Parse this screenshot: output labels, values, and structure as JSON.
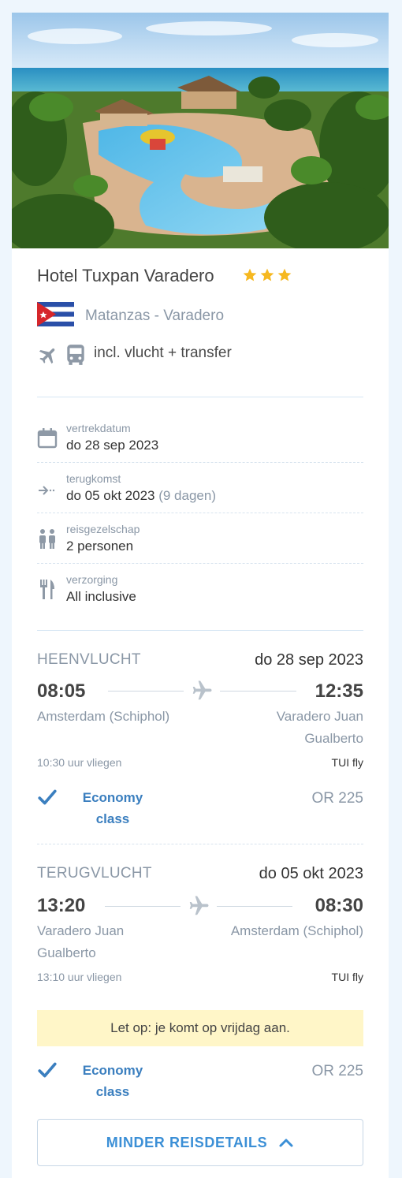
{
  "hotel": {
    "name": "Hotel Tuxpan Varadero",
    "stars": 3,
    "location": "Matanzas - Varadero",
    "includes": "incl. vlucht + transfer",
    "icons": [
      "plane-icon",
      "bus-icon"
    ]
  },
  "details": [
    {
      "icon": "calendar-icon",
      "label": "vertrekdatum",
      "value": "do 28 sep 2023",
      "extra": ""
    },
    {
      "icon": "arrow-right-icon",
      "label": "terugkomst",
      "value": "do 05 okt 2023",
      "extra": "(9 dagen)"
    },
    {
      "icon": "people-icon",
      "label": "reisgezelschap",
      "value": "2 personen",
      "extra": ""
    },
    {
      "icon": "cutlery-icon",
      "label": "verzorging",
      "value": "All inclusive",
      "extra": ""
    }
  ],
  "outbound": {
    "title": "HEENVLUCHT",
    "date": "do 28 sep 2023",
    "depart_time": "08:05",
    "arrive_time": "12:35",
    "from": "Amsterdam (Schiphol)",
    "to_line1": "Varadero Juan",
    "to_line2": "Gualberto",
    "duration": "10:30 uur vliegen",
    "airline": "TUI fly",
    "class_line1": "Economy",
    "class_line2": "class",
    "flight_no": "OR 225"
  },
  "return": {
    "title": "TERUGVLUCHT",
    "date": "do 05 okt 2023",
    "depart_time": "13:20",
    "arrive_time": "08:30",
    "from_line1": "Varadero Juan",
    "from_line2": "Gualberto",
    "to": "Amsterdam (Schiphol)",
    "duration": "13:10 uur vliegen",
    "airline": "TUI fly",
    "notice": "Let op: je komt op vrijdag aan.",
    "class_line1": "Economy",
    "class_line2": "class",
    "flight_no": "OR 225"
  },
  "buttons": {
    "less_details": "MINDER REISDETAILS"
  },
  "colors": {
    "accent": "#3b8fd6",
    "star": "#f6b820",
    "notice_bg": "#fff6c8",
    "page_bg": "#eef6fd"
  }
}
